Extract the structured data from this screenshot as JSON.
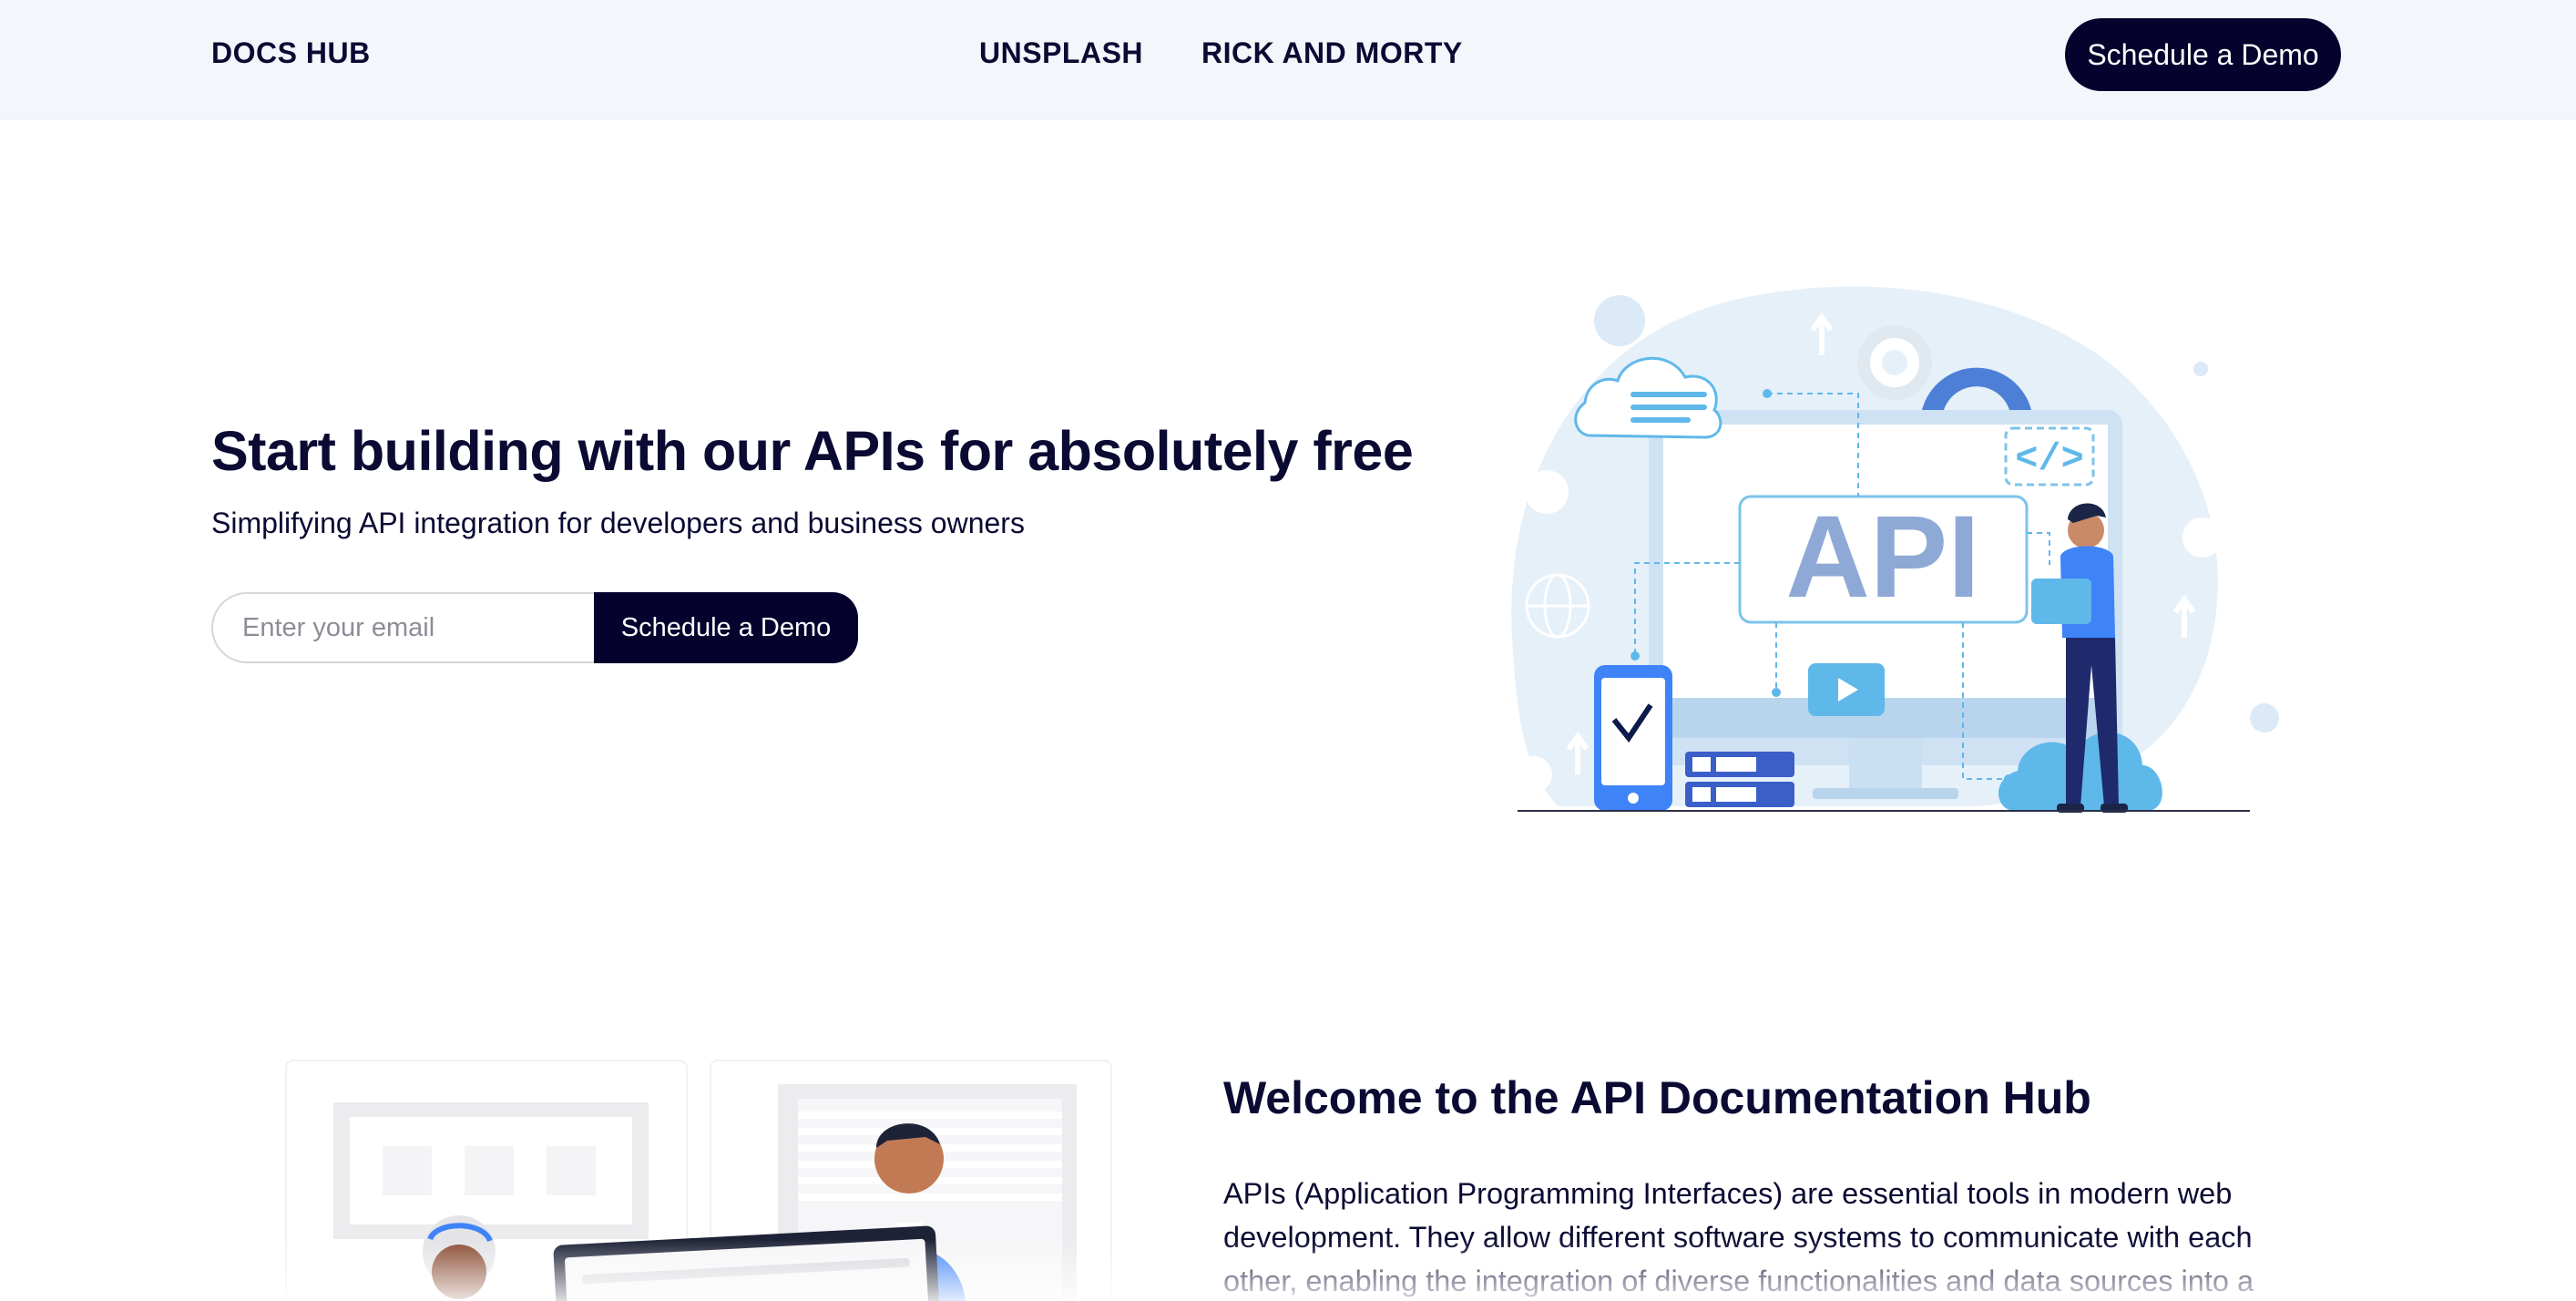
{
  "header": {
    "brand": "DOCS HUB",
    "nav": [
      {
        "label": "UNSPLASH"
      },
      {
        "label": "RICK AND MORTY"
      }
    ],
    "cta_label": "Schedule a Demo"
  },
  "hero": {
    "title": "Start building with our APIs for absolutely free",
    "subtitle": "Simplifying API integration for developers and business owners",
    "email_placeholder": "Enter your email",
    "email_value": "",
    "cta_label": "Schedule a Demo",
    "illustration_text": "API"
  },
  "welcome": {
    "title": "Welcome to the API Documentation Hub",
    "body": "APIs (Application Programming Interfaces) are essential tools in modern web development. They allow different software systems to communicate with each other, enabling the integration of diverse functionalities and data sources into a"
  },
  "colors": {
    "navy": "#05032e",
    "text": "#0b0a33",
    "header_bg": "#f5f6fb",
    "accent_blue": "#3f83f8",
    "light_blue": "#dbe9f6"
  }
}
